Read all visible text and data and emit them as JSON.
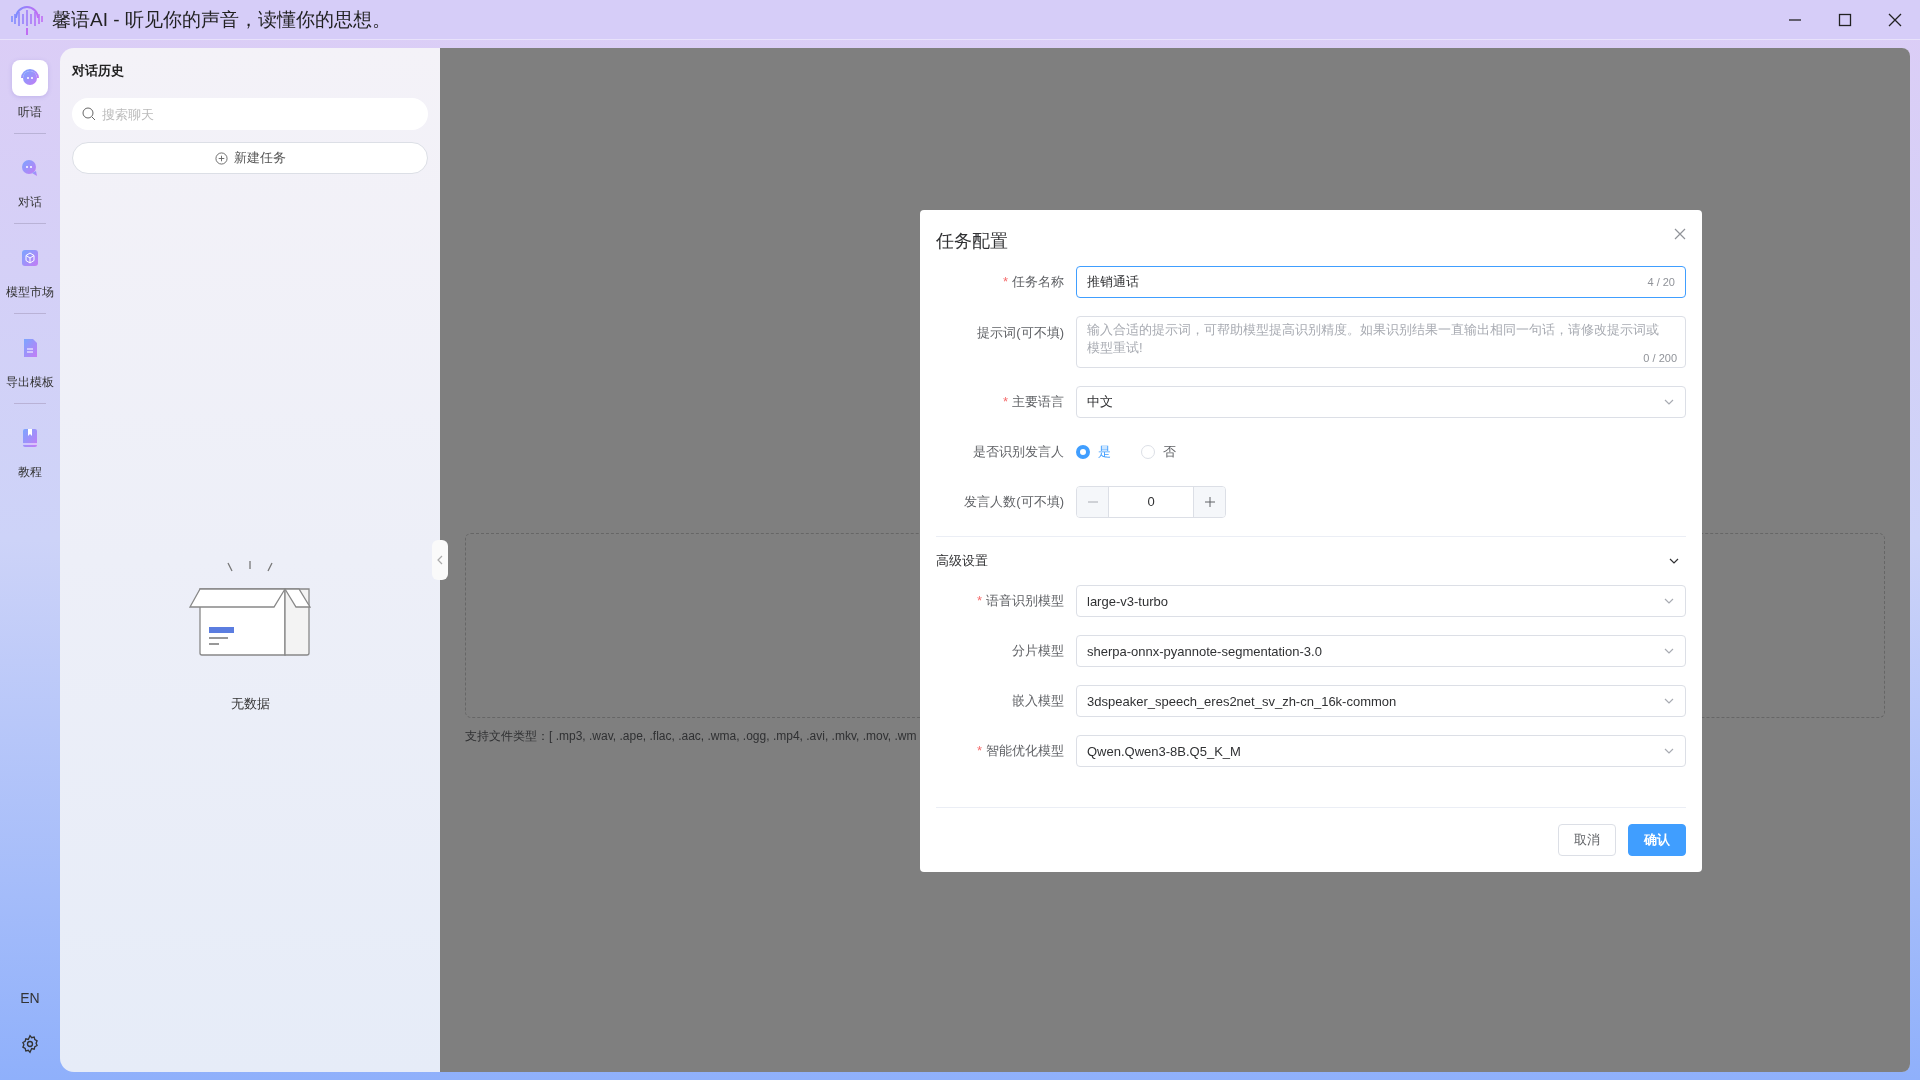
{
  "window": {
    "title": "馨语AI - 听见你的声音，读懂你的思想。"
  },
  "nav": {
    "items": [
      {
        "label": "听语",
        "selected": true
      },
      {
        "label": "对话",
        "selected": false
      },
      {
        "label": "模型市场",
        "selected": false
      },
      {
        "label": "导出模板",
        "selected": false
      },
      {
        "label": "教程",
        "selected": false
      }
    ],
    "language": "EN"
  },
  "history": {
    "title": "对话历史",
    "search": {
      "placeholder": "搜索聊天"
    },
    "new_button": "新建任务",
    "empty_text": "无数据"
  },
  "main": {
    "file_types": "支持文件类型：[ .mp3, .wav, .ape, .flac, .aac, .wma, .ogg, .mp4, .avi, .mkv, .mov, .wm"
  },
  "dialog": {
    "title": "任务配置",
    "fields": [
      {
        "kind": "text",
        "label": "任务名称",
        "marker": "*",
        "value": "推销通话",
        "counter": "4 / 20"
      },
      {
        "kind": "textarea",
        "label": "提示词(可不填)",
        "placeholder": "输入合适的提示词，可帮助模型提高识别精度。如果识别结果一直输出相同一句话，请修改提示词或模型重试!",
        "counter": "0 / 200"
      },
      {
        "kind": "select",
        "label": "主要语言",
        "marker": "*",
        "value": "中文"
      },
      {
        "kind": "radio",
        "label": "是否识别发言人",
        "options": [
          {
            "label": "是",
            "selected": true
          },
          {
            "label": "否",
            "selected": false
          }
        ]
      },
      {
        "kind": "number",
        "label": "发言人数(可不填)",
        "value": "0"
      }
    ],
    "advanced": {
      "title": "高级设置",
      "expanded": true,
      "fields": [
        {
          "kind": "select",
          "label": "语音识别模型",
          "marker": "*",
          "value": "large-v3-turbo"
        },
        {
          "kind": "select",
          "label": "分片模型",
          "value": "sherpa-onnx-pyannote-segmentation-3.0"
        },
        {
          "kind": "select",
          "label": "嵌入模型",
          "value": "3dspeaker_speech_eres2net_sv_zh-cn_16k-common"
        },
        {
          "kind": "select",
          "label": "智能优化模型",
          "marker": "*",
          "value": "Qwen.Qwen3-8B.Q5_K_M"
        }
      ]
    },
    "buttons": [
      {
        "label": "取消",
        "kind": "default"
      },
      {
        "label": "确认",
        "kind": "primary"
      }
    ]
  }
}
